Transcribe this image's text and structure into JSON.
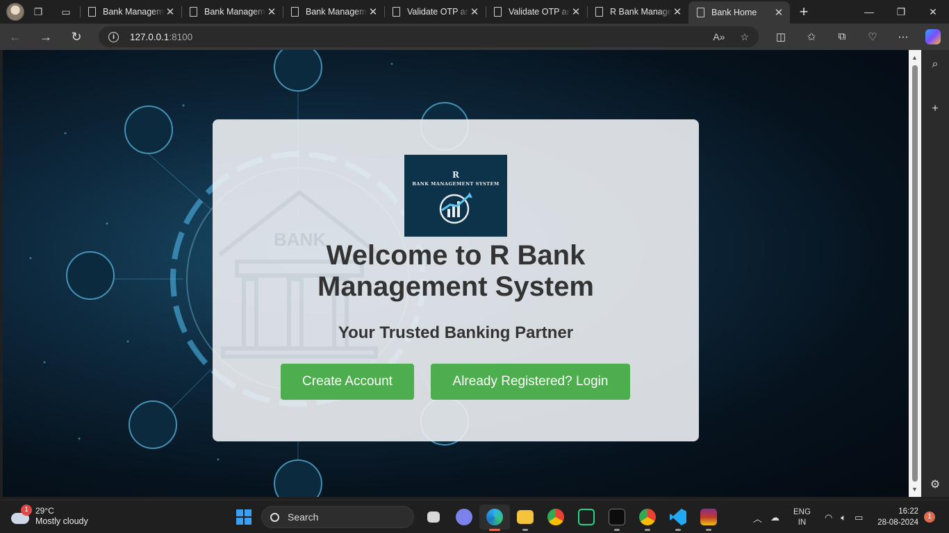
{
  "browser": {
    "tabs": [
      {
        "title": "Bank Management System",
        "active": false
      },
      {
        "title": "Bank Management System",
        "active": false
      },
      {
        "title": "Bank Management System",
        "active": false
      },
      {
        "title": "Validate OTP and Register",
        "active": false
      },
      {
        "title": "Validate OTP and Register",
        "active": false
      },
      {
        "title": "R Bank Management System",
        "active": false
      },
      {
        "title": "Bank Home",
        "active": true
      }
    ],
    "url_host": "127.0.0.1",
    "url_port": ":8100"
  },
  "page": {
    "logo": {
      "letter": "R",
      "text": "BANK MANAGEMENT SYSTEM"
    },
    "heading": "Welcome to R Bank Management System",
    "tagline": "Your Trusted Banking Partner",
    "create_button": "Create Account",
    "login_button": "Already Registered? Login",
    "bg_text": "BANK"
  },
  "taskbar": {
    "weather_temp": "29°C",
    "weather_desc": "Mostly cloudy",
    "weather_badge": "1",
    "search_label": "Search",
    "lang_line1": "ENG",
    "lang_line2": "IN",
    "time": "16:22",
    "date": "28-08-2024",
    "notification_count": "1"
  },
  "colors": {
    "accent_button": "#4cae4c",
    "logo_bg": "#0c3349",
    "card_bg": "#edf0f3"
  }
}
